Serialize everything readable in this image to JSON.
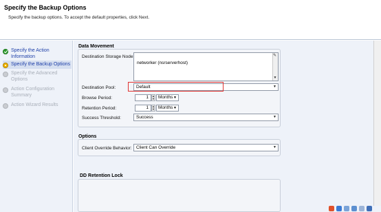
{
  "header": {
    "title": "Specify the Backup Options",
    "description": "Specify the backup options. To accept the default properties, click Next."
  },
  "sidebar": {
    "steps": [
      {
        "label": "Specify the Action Information",
        "state": "done"
      },
      {
        "label": "Specify the Backup Options",
        "state": "current"
      },
      {
        "label": "Specify the Advanced Options",
        "state": "pending"
      },
      {
        "label": "Action Configuration Summary",
        "state": "pending"
      },
      {
        "label": "Action Wizard Results",
        "state": "pending"
      }
    ]
  },
  "data_movement": {
    "title": "Data Movement",
    "destination_storage_node_label": "Destination Storage Node:",
    "destination_storage_node_value": "networker (nsrserverhost)",
    "destination_pool_label": "Destination Pool:",
    "destination_pool_value": "Default",
    "browse_period_label": "Browse Period:",
    "browse_period_value": "1",
    "browse_period_unit": "Months",
    "retention_period_label": "Retention Period:",
    "retention_period_value": "1",
    "retention_period_unit": "Months",
    "success_threshold_label": "Success Threshold:",
    "success_threshold_value": "Success"
  },
  "options": {
    "title": "Options",
    "client_override_label": "Client Override Behavior:",
    "client_override_value": "Client Can Override"
  },
  "dd_retention_lock": {
    "title": "DD Retention Lock"
  },
  "colors": {
    "accent": "#1d3fa8",
    "highlight": "#e0312f",
    "panel_bg": "#eef2f9"
  }
}
